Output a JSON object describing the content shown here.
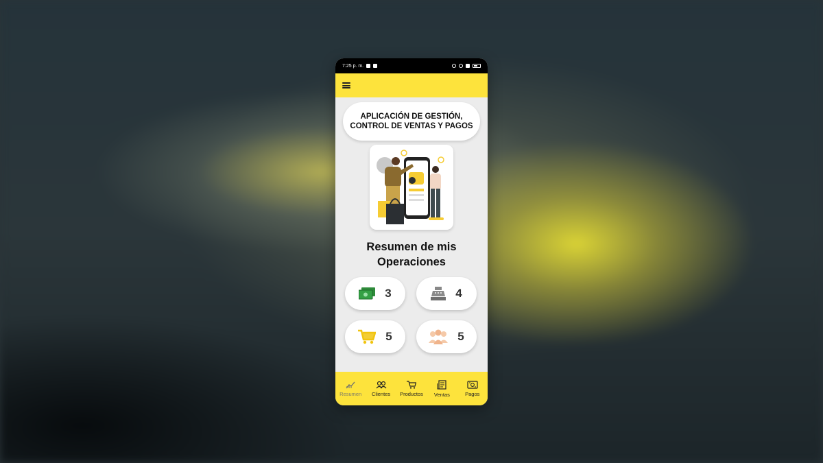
{
  "status_bar": {
    "time": "7:25 p. m."
  },
  "app": {
    "title_line1": "APLICACIÓN DE GESTIÓN,",
    "title_line2": "CONTROL DE VENTAS Y PAGOS",
    "heading_line1": "Resumen de mis",
    "heading_line2": "Operaciones"
  },
  "stats": [
    {
      "icon": "money-icon",
      "value": "3",
      "color": "#2e8b3a"
    },
    {
      "icon": "cash-register-icon",
      "value": "4",
      "color": "#7d7d7d"
    },
    {
      "icon": "cart-icon",
      "value": "5",
      "color": "#f1c40f"
    },
    {
      "icon": "people-icon",
      "value": "5",
      "color": "#f5c9a8"
    }
  ],
  "nav": [
    {
      "label": "Resumen",
      "icon": "chart-icon",
      "active": true
    },
    {
      "label": "Clientes",
      "icon": "users-icon"
    },
    {
      "label": "Productos",
      "icon": "cart-icon"
    },
    {
      "label": "Ventas",
      "icon": "receipt-icon"
    },
    {
      "label": "Pagos",
      "icon": "money-icon"
    }
  ],
  "colors": {
    "accent": "#fde33c",
    "background": "#ececec"
  }
}
